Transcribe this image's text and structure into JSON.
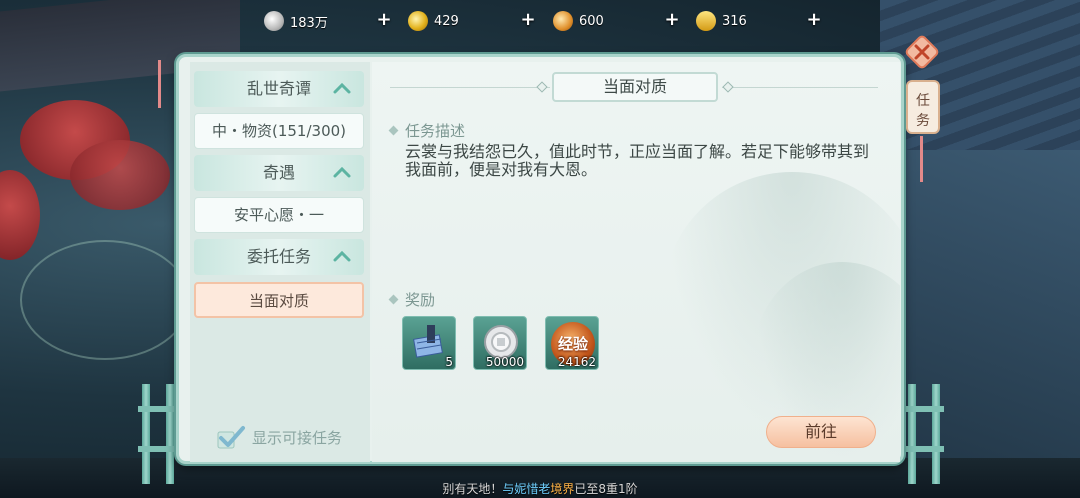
{
  "currency": [
    {
      "name": "silver",
      "value": "183万"
    },
    {
      "name": "gold",
      "value": "429"
    },
    {
      "name": "ticket",
      "value": "600"
    },
    {
      "name": "ingot",
      "value": "316"
    }
  ],
  "sidebar": {
    "categories": [
      {
        "label": "乱世奇谭",
        "item": "中・物资(151/300)"
      },
      {
        "label": "奇遇",
        "item": "安平心愿・一"
      },
      {
        "label": "委托任务",
        "item": "当面对质"
      }
    ],
    "show_available_label": "显示可接任务"
  },
  "quest": {
    "title": "当面对质",
    "desc_heading": "任务描述",
    "description": "云裳与我结怨已久，值此时节，正应当面了解。若足下能够带其到我面前，便是对我有大恩。",
    "reward_heading": "奖励",
    "rewards": [
      {
        "icon": "blueprint-icon",
        "qty": "5"
      },
      {
        "icon": "silver-coin-icon",
        "qty": "50000"
      },
      {
        "icon": "experience-icon",
        "label": "经验",
        "qty": "24162"
      }
    ],
    "go_button": "前往"
  },
  "quest_tag": {
    "line1": "任",
    "line2": "务"
  },
  "ticker": {
    "part1": "别有天地！",
    "part2": "与妮惜老",
    "part3": "境界",
    "part4": "已至8重1阶"
  },
  "colors": {
    "panel_bg": "#e8f1ee",
    "accent_teal": "#5f9b92",
    "selected_item": "#fde9dc",
    "go_button": "#f6c0a0"
  }
}
